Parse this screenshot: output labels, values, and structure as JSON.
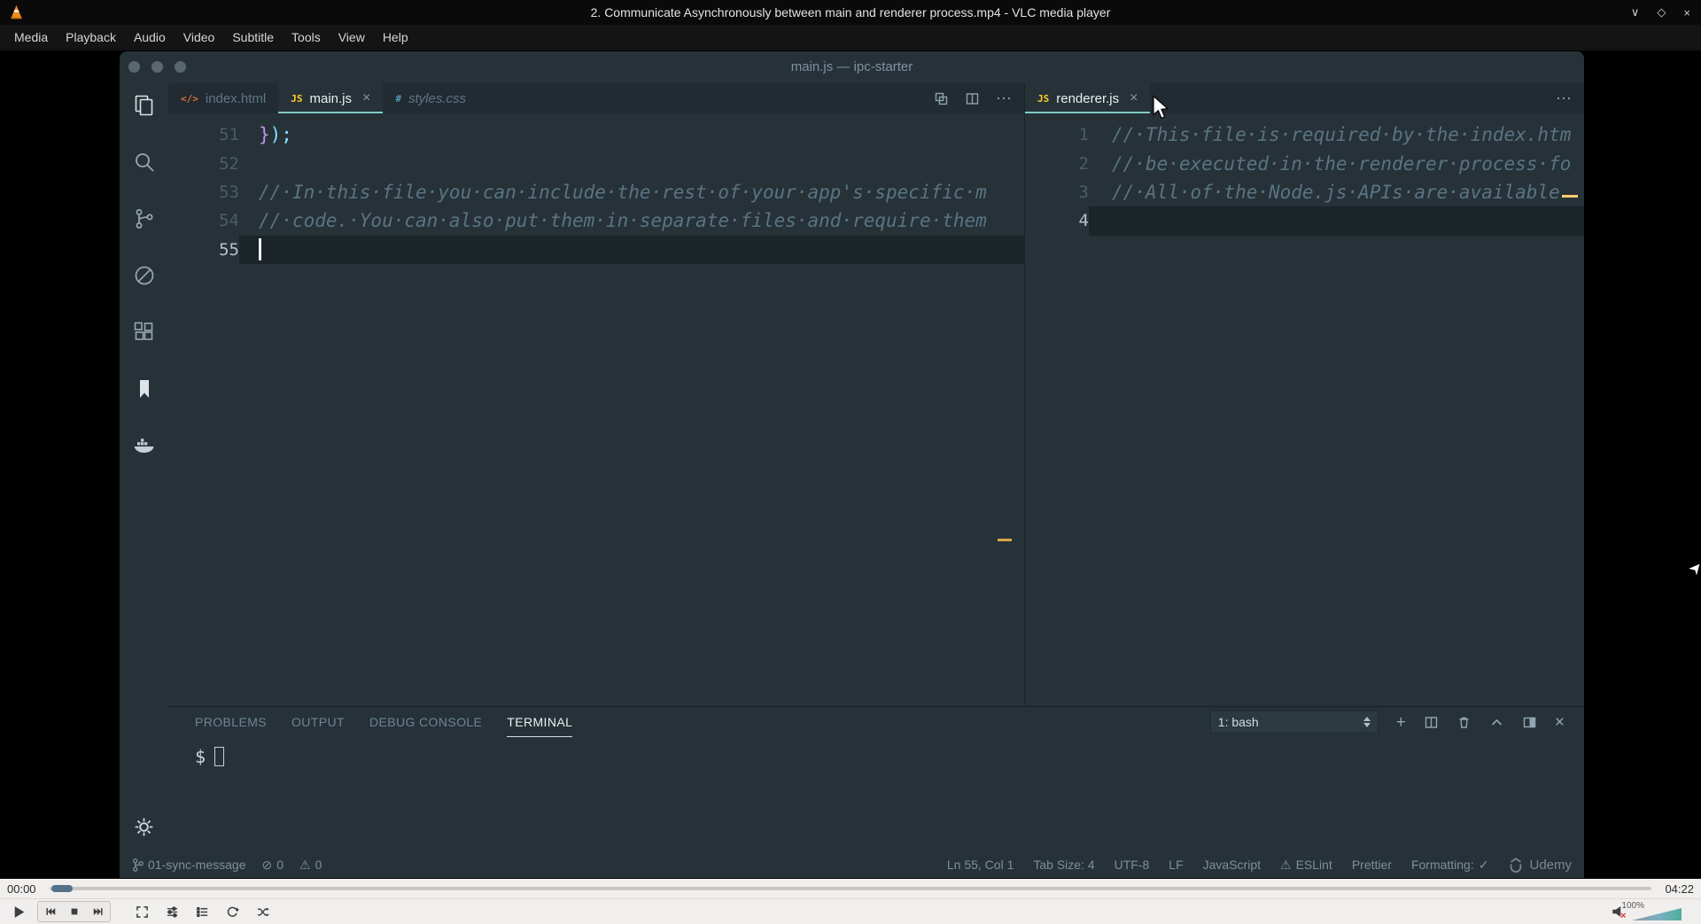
{
  "colors": {
    "accent": "#80cbc4",
    "editor_bg": "#263238",
    "comment": "#5a7482",
    "js_icon": "#ffca28",
    "mute": "#e0342f"
  },
  "vlc": {
    "titlebar": {
      "title": "2. Communicate Asynchronously between main and renderer process.mp4 - VLC media player",
      "minimize_glyph": "∨",
      "maximize_glyph": "◇",
      "close_glyph": "×"
    },
    "menu": {
      "items": [
        "Media",
        "Playback",
        "Audio",
        "Video",
        "Subtitle",
        "Tools",
        "View",
        "Help"
      ]
    },
    "seek": {
      "current": "00:00",
      "total": "04:22"
    },
    "volume": {
      "percent": "100%",
      "mute_glyph": "×"
    }
  },
  "vscode": {
    "window_title": "main.js — ipc-starter",
    "tab_icons": {
      "html": "</>",
      "js": "JS",
      "css": "#"
    },
    "glyphs": {
      "close": "×",
      "more": "⋯",
      "add": "+",
      "check": "✓",
      "warning": "⚠",
      "error": "⊘"
    },
    "left_group": {
      "tabs": [
        {
          "label": "index.html"
        },
        {
          "label": "main.js"
        },
        {
          "label": "styles.css"
        }
      ],
      "line_numbers": [
        "51",
        "52",
        "53",
        "54",
        "55"
      ],
      "line51_brace": "}",
      "line51_rest": ");",
      "line53": "//·In·this·file·you·can·include·the·rest·of·your·app's·specific·m",
      "line54": "//·code.·You·can·also·put·them·in·separate·files·and·require·them"
    },
    "right_group": {
      "tab_label": "renderer.js",
      "line_numbers": [
        "1",
        "2",
        "3",
        "4"
      ],
      "line1": "//·This·file·is·required·by·the·index.htm",
      "line2": "//·be·executed·in·the·renderer·process·fo",
      "line3": "//·All·of·the·Node.js·APIs·are·available"
    },
    "panel": {
      "tabs": [
        "PROBLEMS",
        "OUTPUT",
        "DEBUG CONSOLE",
        "TERMINAL"
      ],
      "prompt": "$",
      "shell_label": "1: bash"
    },
    "status": {
      "branch": "01-sync-message",
      "errors": "0",
      "warnings": "0",
      "cursor_position": "Ln 55, Col 1",
      "tab_size": "Tab Size: 4",
      "encoding": "UTF-8",
      "eol": "LF",
      "language": "JavaScript",
      "eslint": "ESLint",
      "prettier": "Prettier",
      "formatting_label": "Formatting:",
      "watermark": "Udemy"
    }
  }
}
